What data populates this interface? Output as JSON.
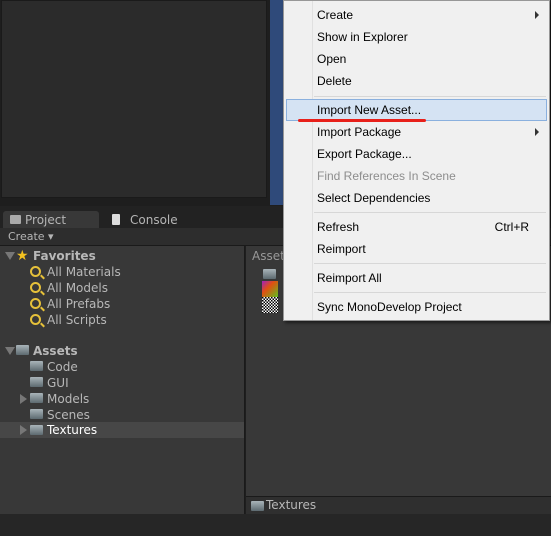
{
  "tabs": [
    {
      "label": "Project",
      "icon": "folder-icon"
    },
    {
      "label": "Console",
      "icon": "console-icon"
    }
  ],
  "toolbar": {
    "create": "Create ▾"
  },
  "favorites": {
    "label": "Favorites",
    "items": [
      "All Materials",
      "All Models",
      "All Prefabs",
      "All Scripts"
    ]
  },
  "assets": {
    "label": "Assets",
    "items": [
      {
        "label": "Code",
        "expandable": false
      },
      {
        "label": "GUI",
        "expandable": false
      },
      {
        "label": "Models",
        "expandable": true
      },
      {
        "label": "Scenes",
        "expandable": false
      },
      {
        "label": "Textures",
        "expandable": true,
        "selected": true
      }
    ]
  },
  "right": {
    "header": "Assets",
    "footer": "Textures"
  },
  "menu": {
    "items": [
      {
        "label": "Create",
        "submenu": true
      },
      {
        "label": "Show in Explorer"
      },
      {
        "label": "Open"
      },
      {
        "label": "Delete"
      },
      {
        "label": "Import New Asset...",
        "highlighted": true
      },
      {
        "label": "Import Package",
        "submenu": true
      },
      {
        "label": "Export Package..."
      },
      {
        "label": "Find References In Scene",
        "disabled": true
      },
      {
        "label": "Select Dependencies"
      },
      {
        "label": "Refresh",
        "shortcut": "Ctrl+R"
      },
      {
        "label": "Reimport"
      },
      {
        "label": "Reimport All"
      },
      {
        "label": "Sync MonoDevelop Project"
      }
    ]
  },
  "colors": {
    "highlight": "#d5e3f3",
    "annotation": "#e8201a",
    "selection": "#474747"
  }
}
